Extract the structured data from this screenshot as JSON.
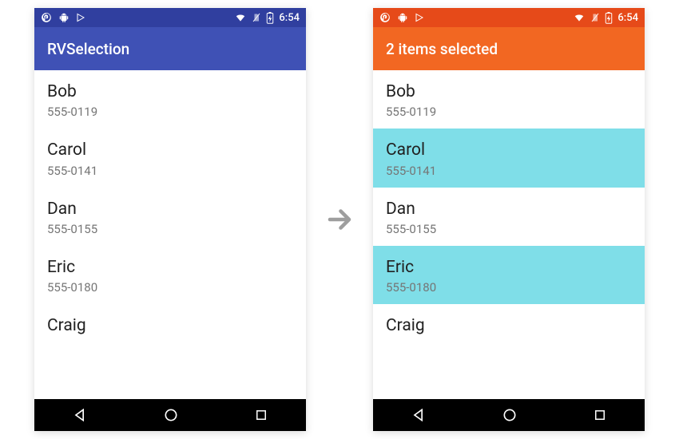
{
  "status": {
    "time": "6:54"
  },
  "arrow_glyph": "→",
  "colors": {
    "indigo_dark": "#303F9F",
    "indigo": "#3F51B5",
    "orange_dark": "#E64A19",
    "orange": "#F26722",
    "selection": "#7fdee8"
  },
  "left": {
    "app_title": "RVSelection",
    "items": [
      {
        "name": "Bob",
        "phone": "555-0119",
        "selected": false
      },
      {
        "name": "Carol",
        "phone": "555-0141",
        "selected": false
      },
      {
        "name": "Dan",
        "phone": "555-0155",
        "selected": false
      },
      {
        "name": "Eric",
        "phone": "555-0180",
        "selected": false
      },
      {
        "name": "Craig",
        "phone": "",
        "selected": false
      }
    ]
  },
  "right": {
    "app_title": "2 items selected",
    "items": [
      {
        "name": "Bob",
        "phone": "555-0119",
        "selected": false
      },
      {
        "name": "Carol",
        "phone": "555-0141",
        "selected": true
      },
      {
        "name": "Dan",
        "phone": "555-0155",
        "selected": false
      },
      {
        "name": "Eric",
        "phone": "555-0180",
        "selected": true
      },
      {
        "name": "Craig",
        "phone": "",
        "selected": false
      }
    ]
  }
}
